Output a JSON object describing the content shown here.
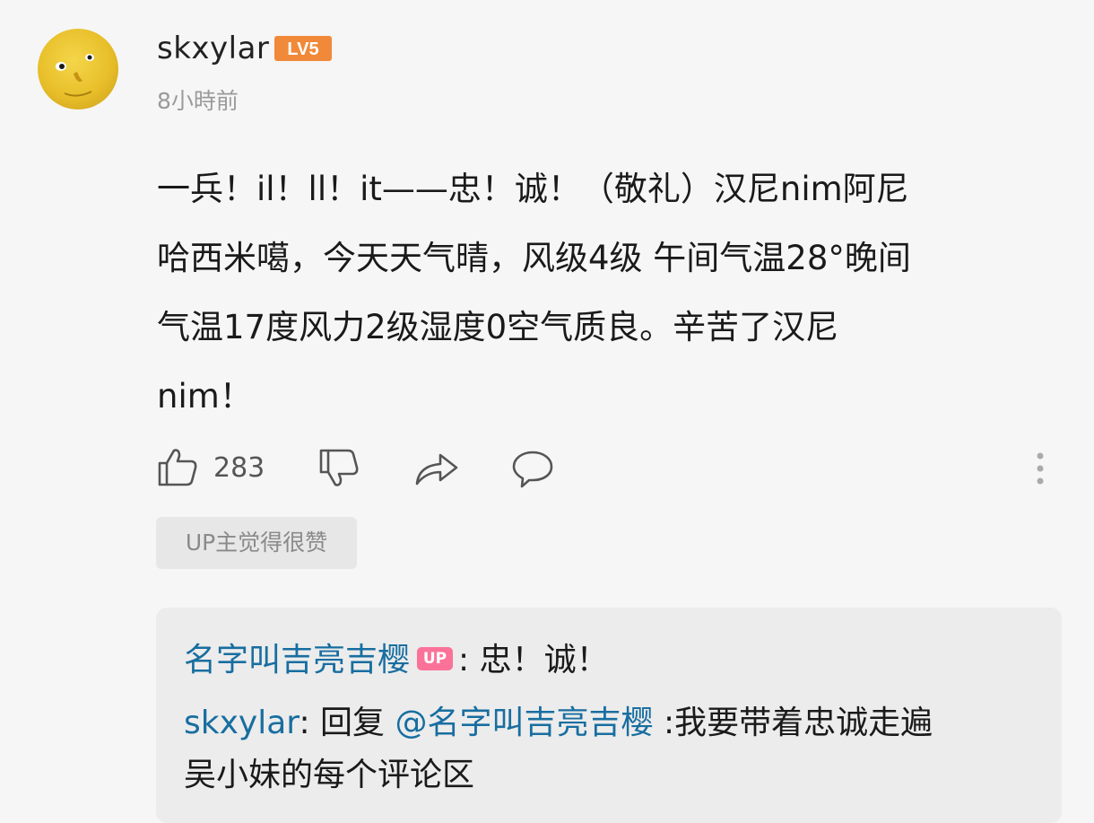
{
  "comment": {
    "username": "skxylar",
    "level_badge": "LV5",
    "timestamp": "8小時前",
    "text_lines": [
      "一兵！il！ll！it——忠！诚！（敬礼）汉尼nim阿尼",
      "哈西米噶，今天天气晴，风级4级 午间气温28°晚间",
      "气温17度风力2级湿度0空气质良。辛苦了汉尼",
      "nim！"
    ],
    "like_count": "283",
    "up_badge": "UP主觉得很赞"
  },
  "replies": {
    "first": {
      "author": "名字叫吉亮吉樱",
      "up_tag": "UP",
      "separator": ":",
      "text": " 忠！诚！"
    },
    "second": {
      "author": "skxylar",
      "separator": ":",
      "reply_prefix": " 回复 ",
      "mention": "@名字叫吉亮吉樱",
      "text_line1": " :我要带着忠诚走遍",
      "text_line2": "吴小妹的每个评论区"
    }
  },
  "icons": {
    "like": "thumbs-up-icon",
    "dislike": "thumbs-down-icon",
    "share": "share-icon",
    "comment": "comment-icon",
    "more": "more-vertical-icon"
  },
  "colors": {
    "link_blue": "#186ea0",
    "level_orange": "#f08a3a",
    "up_pink": "#fb7299"
  }
}
